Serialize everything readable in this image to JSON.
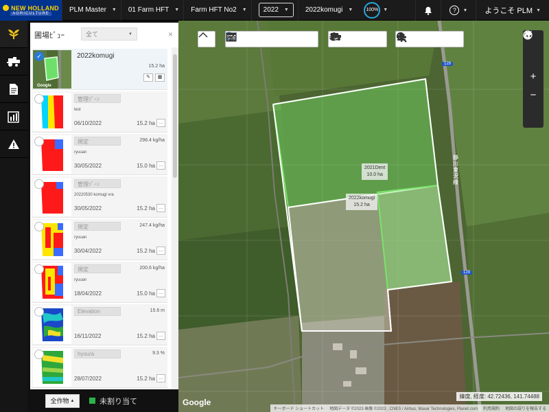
{
  "brand": {
    "name": "NEW HOLLAND",
    "sub": "AGRICULTURE"
  },
  "topbar": {
    "dropdowns": [
      "PLM Master",
      "01 Farm HFT",
      "Farm HFT No2",
      "2022",
      "2022komugi"
    ],
    "zoom": "100%",
    "help_label": "?",
    "user_label": "ようこそ PLM"
  },
  "rail": [
    "crop-icon",
    "harvester-icon",
    "document-icon",
    "report-icon",
    "warning-icon"
  ],
  "panel": {
    "title": "圃場ﾋﾞｭｰ",
    "filter": "全て",
    "close": "×",
    "items": [
      {
        "name": "2022komugi",
        "value": "",
        "sub": "",
        "date": "",
        "ha": "15.2 ha",
        "checked": true
      },
      {
        "name": "管理ｿﾞｰﾝ",
        "value": "",
        "sub": "test",
        "date": "06/10/2022",
        "ha": "15.2 ha",
        "checked": false
      },
      {
        "name": "規定",
        "value": "296.4 kg/ha",
        "sub": "ryuuan",
        "date": "30/05/2022",
        "ha": "15.0 ha",
        "checked": false
      },
      {
        "name": "管理ｿﾞｰﾝ",
        "value": "",
        "sub": "20220530 komugi vra",
        "date": "30/05/2022",
        "ha": "15.2 ha",
        "checked": false
      },
      {
        "name": "規定",
        "value": "247.4 kg/ha",
        "sub": "ryuuan",
        "date": "30/04/2022",
        "ha": "15.2 ha",
        "checked": false
      },
      {
        "name": "規定",
        "value": "200.6 kg/ha",
        "sub": "ryuuan",
        "date": "18/04/2022",
        "ha": "15.0 ha",
        "checked": false
      },
      {
        "name": "Elevation",
        "value": "15.6 m",
        "sub": "",
        "date": "16/11/2022",
        "ha": "15.2 ha",
        "checked": false
      },
      {
        "name": "hyou/a",
        "value": "9.3 %",
        "sub": "",
        "date": "28/07/2022",
        "ha": "15.2 ha",
        "checked": false
      }
    ],
    "menu_glyph": "...",
    "google_mini": "Google"
  },
  "footer": {
    "all_crops": "全作物",
    "unassigned": "未割り当て",
    "unassigned_color": "#2cb34a"
  },
  "map": {
    "fields": [
      {
        "name": "2021Dent",
        "area": "10.0 ha"
      },
      {
        "name": "2022komugi",
        "area": "15.2 ha"
      }
    ],
    "road_label": "静川東沢線",
    "route_numbers": [
      "129",
      "129"
    ],
    "coords": "緯度, 経度: 42.72436, 141.74488",
    "attribution": [
      "キーボード ショートカット",
      "地図データ ©2023 画像 ©2023 , CNES / Airbus, Maxar Technologies, Planet.com",
      "利用規約",
      "地図の誤りを報告する"
    ],
    "google": "Google",
    "accent": "#7be36b"
  }
}
